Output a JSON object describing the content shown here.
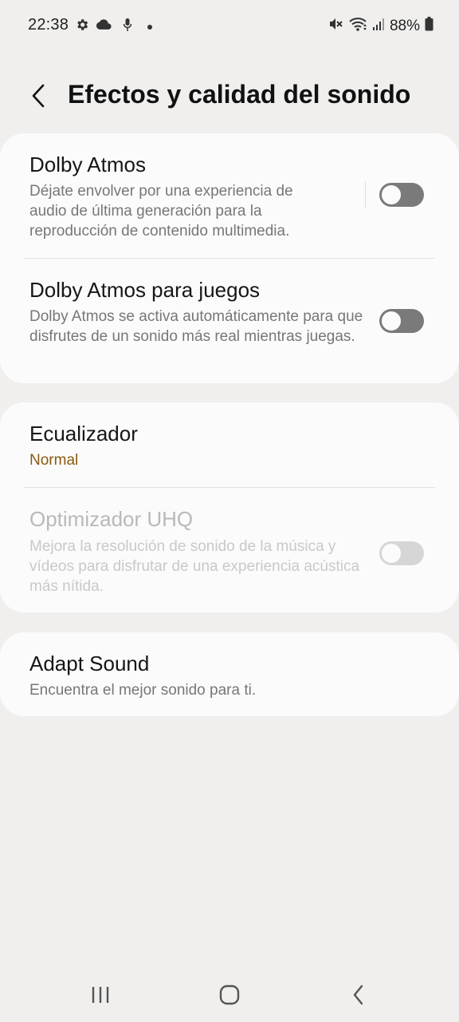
{
  "status_bar": {
    "time": "22:38",
    "battery": "88%",
    "left_icons": [
      "gear-icon",
      "cloud-icon",
      "mic-icon",
      "dot-icon"
    ],
    "right_icons": [
      "mute-icon",
      "wifi-icon",
      "signal-icon",
      "battery-icon"
    ]
  },
  "header": {
    "title": "Efectos y calidad del sonido"
  },
  "sections": [
    {
      "items": [
        {
          "title": "Dolby Atmos",
          "description": "Déjate envolver por una experiencia de audio de última generación para la reproducción de contenido multimedia.",
          "toggle": "off"
        },
        {
          "title": "Dolby Atmos para juegos",
          "description": "Dolby Atmos se activa automáticamente para que disfrutes de un sonido más real mientras juegas.",
          "toggle": "off"
        }
      ]
    },
    {
      "items": [
        {
          "title": "Ecualizador",
          "value": "Normal"
        },
        {
          "title": "Optimizador UHQ",
          "description": "Mejora la resolución de sonido de la música y vídeos para disfrutar de una experiencia acústica más nítida.",
          "toggle": "off",
          "disabled": true
        }
      ]
    },
    {
      "items": [
        {
          "title": "Adapt Sound",
          "description": "Encuentra el mejor sonido para ti."
        }
      ]
    }
  ],
  "nav_bar": {
    "buttons": [
      "recents-icon",
      "home-icon",
      "back-icon"
    ]
  },
  "colors": {
    "background": "#f0efee",
    "card": "#fbfbfb",
    "accent_value": "#8a5a10",
    "toggle_off": "#7a7a7a",
    "toggle_disabled": "#d6d6d6"
  }
}
